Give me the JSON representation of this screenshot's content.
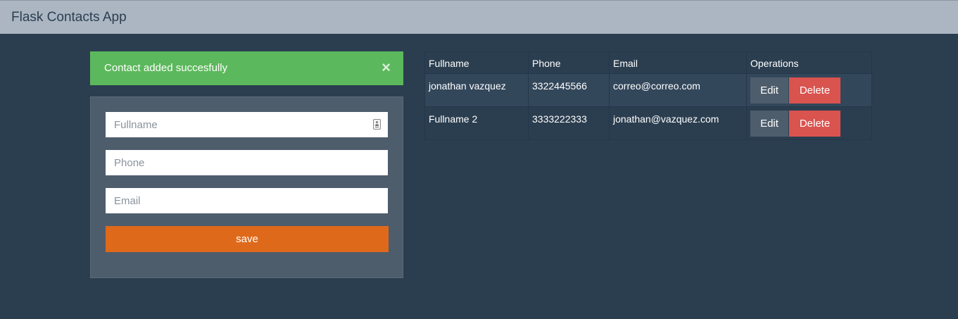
{
  "navbar": {
    "brand": "Flask Contacts App"
  },
  "alert": {
    "message": "Contact added succesfully",
    "close_symbol": "×",
    "color": "#5cb85c"
  },
  "form": {
    "fullname_placeholder": "Fullname",
    "fullname_value": "",
    "fullname_icon": "contact-card-icon",
    "phone_placeholder": "Phone",
    "phone_value": "",
    "email_placeholder": "Email",
    "email_value": "",
    "save_label": "save",
    "save_color": "#df691a"
  },
  "table": {
    "headers": {
      "fullname": "Fullname",
      "phone": "Phone",
      "email": "Email",
      "operations": "Operations"
    },
    "rows": [
      {
        "fullname": "jonathan vazquez",
        "phone": "3322445566",
        "email": "correo@correo.com",
        "edit_label": "Edit",
        "delete_label": "Delete"
      },
      {
        "fullname": "Fullname 2",
        "phone": "3333222333",
        "email": "jonathan@vazquez.com",
        "edit_label": "Edit",
        "delete_label": "Delete"
      }
    ]
  },
  "colors": {
    "background": "#2b3e50",
    "navbar": "#abb6c2",
    "card": "#4e5d6c",
    "delete": "#d9534f"
  }
}
